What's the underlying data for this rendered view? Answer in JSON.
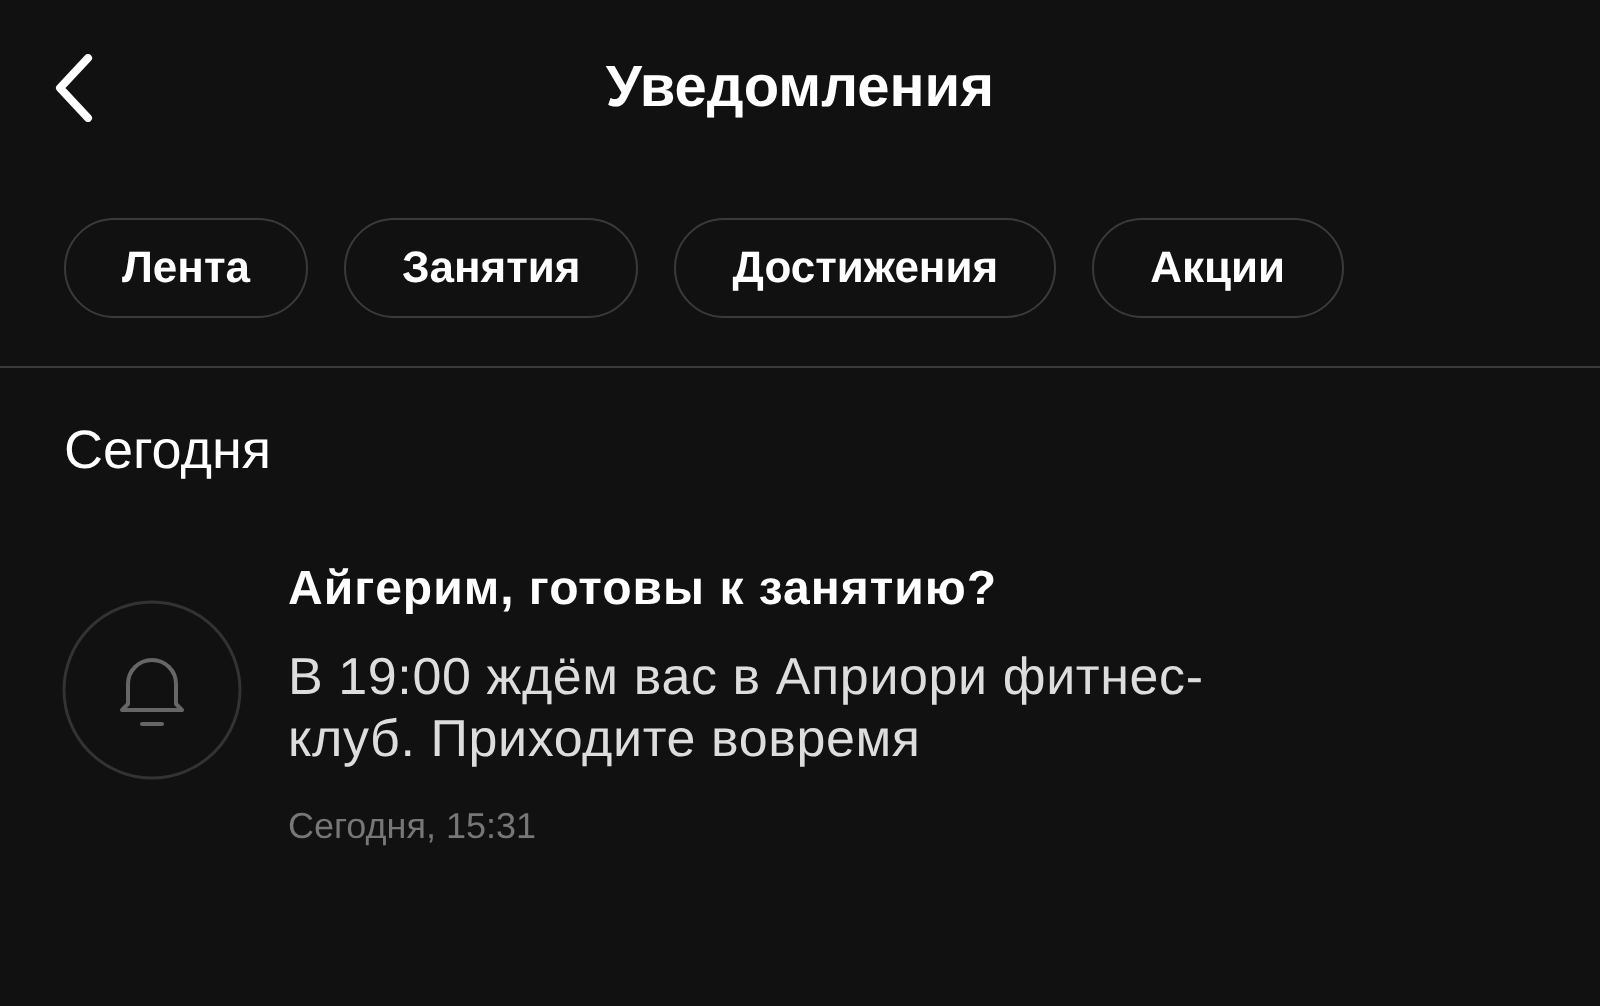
{
  "header": {
    "title": "Уведомления"
  },
  "filters": [
    {
      "label": "Лента"
    },
    {
      "label": "Занятия"
    },
    {
      "label": "Достижения"
    },
    {
      "label": "Акции"
    }
  ],
  "section": "Сегодня",
  "notifications": [
    {
      "title": "Айгерим, готовы к занятию?",
      "body": "В 19:00 ждём вас в Априори фитнес-клуб. Приходите вовремя",
      "time": "Сегодня, 15:31"
    }
  ]
}
